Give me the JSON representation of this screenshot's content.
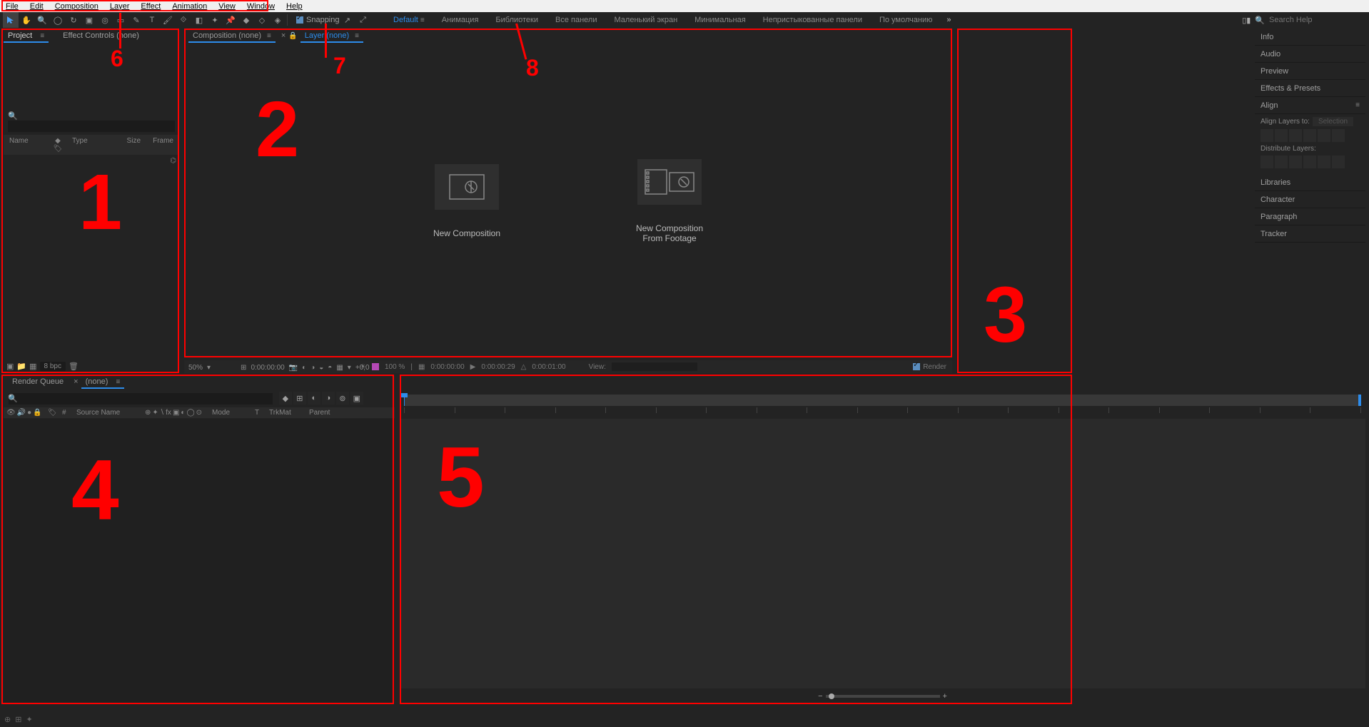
{
  "menu": [
    "File",
    "Edit",
    "Composition",
    "Layer",
    "Effect",
    "Animation",
    "View",
    "Window",
    "Help"
  ],
  "toolbar": {
    "snapping_label": "Snapping"
  },
  "workspaces": {
    "active": "Default",
    "items": [
      "Default",
      "Анимация",
      "Библиотеки",
      "Все панели",
      "Маленький экран",
      "Минимальная",
      "Непристыкованные панели",
      "По умолчанию"
    ],
    "more_glyph": "»"
  },
  "search": {
    "placeholder": "Search Help"
  },
  "project_panel": {
    "tab_project": "Project",
    "tab_effect_controls": "Effect Controls (none)",
    "columns": {
      "name": "Name",
      "type": "Type",
      "size": "Size",
      "frame": "Frame"
    },
    "bpc": "8 bpc"
  },
  "comp_panel": {
    "tab_comp": "Composition (none)",
    "tab_layer": "Layer (none)",
    "new_comp_label": "New Composition",
    "new_from_footage_l1": "New Composition",
    "new_from_footage_l2": "From Footage",
    "footer": {
      "zoom_pct": "100 %",
      "time_a": "0:00:00:00",
      "time_b": "0:00:00:29",
      "time_c": "0:00:01:00",
      "view_label": "View:",
      "render_label": "Render"
    },
    "lower_toolbar": {
      "zoom_pct": "50%",
      "time": "0:00:00:00",
      "adj": "+0,0"
    }
  },
  "right_panels": {
    "info": "Info",
    "audio": "Audio",
    "preview": "Preview",
    "effects_presets": "Effects & Presets",
    "align": {
      "title": "Align",
      "align_to": "Align Layers to:",
      "distribute": "Distribute Layers:",
      "select_placeholder": "Selection"
    },
    "libraries": "Libraries",
    "character": "Character",
    "paragraph": "Paragraph",
    "tracker": "Tracker"
  },
  "timeline_panel": {
    "tab_render_queue": "Render Queue",
    "tab_none": "(none)",
    "columns": {
      "idx": "#",
      "source_name": "Source Name",
      "mode": "Mode",
      "t": "T",
      "trkmat": "TrkMat",
      "parent": "Parent"
    }
  },
  "annotations": {
    "n1": "1",
    "n2": "2",
    "n3": "3",
    "n4": "4",
    "n5": "5",
    "n6": "6",
    "n7": "7",
    "n8": "8"
  }
}
